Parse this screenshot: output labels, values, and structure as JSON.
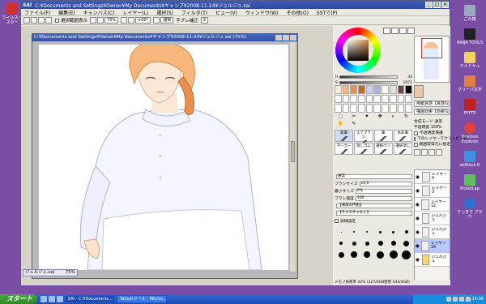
{
  "desktop": {
    "left_icons": [
      {
        "label": "ウィルスバスター"
      }
    ],
    "right_icons": [
      {
        "label": "ごみ箱"
      },
      {
        "label": "NINJA TOOLS"
      },
      {
        "label": "マイドキュ"
      },
      {
        "label": "クリーパ文字"
      },
      {
        "label": "FFFTP"
      },
      {
        "label": "Daemon Explorer"
      },
      {
        "label": "ebiBack R"
      },
      {
        "label": "PicketLap"
      },
      {
        "label": "すっきり ブラウ"
      }
    ]
  },
  "app": {
    "logo": "SAI",
    "title": "C:¥Documents and Settings¥Owner¥My Documents¥キャンプ¥2008-11-24¥ジュルジュ.sai",
    "menu": [
      "ファイル(F)",
      "編集(E)",
      "キャンバス(C)",
      "レイヤー(L)",
      "選択(S)",
      "フィルタ(T)",
      "ビュー(V)",
      "ウィンドウ(W)",
      "その他(O)",
      "SSTで(P)"
    ],
    "toolbar": {
      "check_label": "選択範囲表示",
      "zoom_value": "75%",
      "rotate_value": "+00°",
      "mode_value": "通常",
      "shake_label": "手ブレ補正",
      "shake_value": "3"
    }
  },
  "document": {
    "title": "C:¥Documents and Settings¥Owner¥My Documents¥キャンプ¥2008-11-24¥ジュルジュ.sai (75%)",
    "tab_label": "ジュルジュ.sai",
    "tab_zoom": "75%"
  },
  "color_panel": {
    "sliders": [
      {
        "label": "H",
        "value": "33"
      },
      {
        "label": "S",
        "value": "1071"
      }
    ],
    "layer_mode": "通常",
    "blend": "不透明度",
    "opacity_label": "100%"
  },
  "boxes": {
    "paper_texture": "用紙質感【質感なし】",
    "paper_effect": "描画効果【効果なし】",
    "blend_mode_label": "合成モード",
    "blend_mode_value": "通常",
    "opacity_label": "不透明度",
    "opacity_value": "100%"
  },
  "layer_options": [
    "不透明度保護",
    "下のレイヤーでクリッピング",
    "範囲取得元に指定"
  ],
  "brush_tools": [
    {
      "label": "鉛筆"
    },
    {
      "label": "エアブラシ"
    },
    {
      "label": "筆"
    },
    {
      "label": "水彩筆"
    },
    {
      "label": "マーカー"
    },
    {
      "label": "消しゴム"
    },
    {
      "label": "選択ペン"
    },
    {
      "label": "選択消し"
    }
  ],
  "brush_props": [
    {
      "label": "通常",
      "value": ""
    },
    {
      "label": "ブラシサイズ",
      "value": "x1.0"
    },
    {
      "label": "最小サイズ",
      "value": "0%"
    },
    {
      "label": "ブラシ濃度",
      "value": "100"
    },
    {
      "label": "【通常の円形】",
      "value": ""
    },
    {
      "label": "【テクスチャなし】",
      "value": ""
    },
    {
      "label": "詳細設定",
      "value": ""
    }
  ],
  "brush_sizes": [
    "1",
    "2",
    "3",
    "4",
    "5",
    "6",
    "7",
    "8",
    "9",
    "10",
    "12",
    "14",
    "16",
    "20",
    "25",
    "30",
    "35",
    "40"
  ],
  "layers": [
    {
      "name": "レイヤー4",
      "mode": "通常",
      "opacity": "100%",
      "selected": false,
      "folder": false
    },
    {
      "name": "レイヤー3",
      "mode": "通常",
      "opacity": "100%",
      "selected": false,
      "folder": false
    },
    {
      "name": "レイヤー12",
      "mode": "通常",
      "opacity": "100%",
      "selected": false,
      "folder": false
    },
    {
      "name": "ジュルジュ",
      "mode": "通常",
      "opacity": "100%",
      "selected": false,
      "folder": false
    },
    {
      "name": "ジュルジュ",
      "mode": "通常",
      "opacity": "100%",
      "selected": false,
      "folder": false
    },
    {
      "name": "レイヤー16",
      "mode": "通常",
      "opacity": "100%",
      "selected": true,
      "folder": false
    },
    {
      "name": "ジュルジュ",
      "mode": "通常",
      "opacity": "100%",
      "selected": false,
      "folder": true
    }
  ],
  "statusbar": "メモリ負荷率 42% (327/4GB使用 543/4GB)",
  "taskbar": {
    "start_label": "スタート",
    "tasks": [
      {
        "label": "SAI - C:¥Documents..."
      },
      {
        "label": "Yahoo!メール - Micros..."
      }
    ],
    "clock": "14:08"
  },
  "colors": {
    "accent": "#3553a8",
    "desktop": "#7b4ea5",
    "taskbar": "#245edb",
    "selected_layer": "#b8c8ff"
  }
}
